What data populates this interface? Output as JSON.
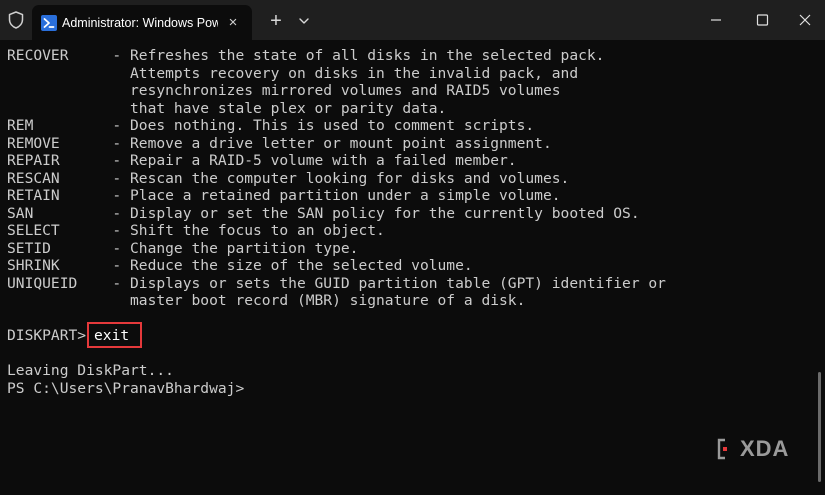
{
  "window": {
    "tab_title": "Administrator: Windows Powe",
    "tab_close_icon": "×",
    "new_tab_icon": "+"
  },
  "terminal": {
    "lines": [
      "RECOVER     - Refreshes the state of all disks in the selected pack.",
      "              Attempts recovery on disks in the invalid pack, and",
      "              resynchronizes mirrored volumes and RAID5 volumes",
      "              that have stale plex or parity data.",
      "REM         - Does nothing. This is used to comment scripts.",
      "REMOVE      - Remove a drive letter or mount point assignment.",
      "REPAIR      - Repair a RAID-5 volume with a failed member.",
      "RESCAN      - Rescan the computer looking for disks and volumes.",
      "RETAIN      - Place a retained partition under a simple volume.",
      "SAN         - Display or set the SAN policy for the currently booted OS.",
      "SELECT      - Shift the focus to an object.",
      "SETID       - Change the partition type.",
      "SHRINK      - Reduce the size of the selected volume.",
      "UNIQUEID    - Displays or sets the GUID partition table (GPT) identifier or",
      "              master boot record (MBR) signature of a disk."
    ],
    "prompt": "DISKPART>",
    "command": "exit",
    "output_line": "Leaving DiskPart...",
    "ps_prompt": "PS C:\\Users\\PranavBhardwaj>"
  },
  "watermark": {
    "text": "XDA"
  },
  "colors": {
    "background": "#0c0c0c",
    "titlebar": "#1f1f1f",
    "text": "#cccccc",
    "highlight_border": "#e5393b",
    "powershell_icon": "#2a6fdb"
  },
  "icons": [
    "shield-icon",
    "powershell-icon",
    "close-icon",
    "plus-icon",
    "chevron-down-icon",
    "minimize-icon",
    "maximize-icon",
    "close-window-icon"
  ]
}
